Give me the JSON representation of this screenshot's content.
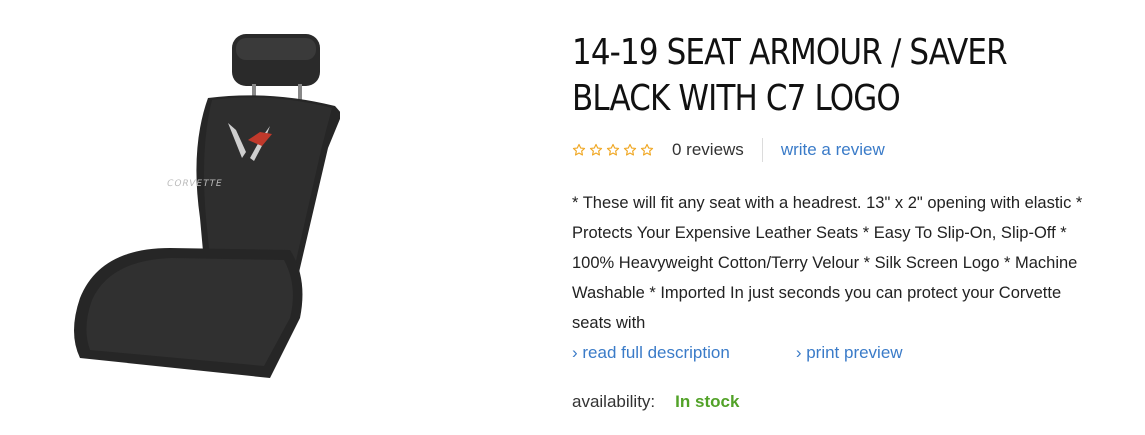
{
  "product": {
    "title": "14-19 SEAT ARMOUR / SAVER BLACK WITH C7 LOGO",
    "image_logo_text": "CORVETTE",
    "rating": {
      "stars_filled": 0,
      "stars_total": 5,
      "reviews_label": "0 reviews",
      "write_review_label": "write a review"
    },
    "description": "* These will fit any seat with a headrest. 13\" x 2\" opening with elastic * Protects Your Expensive Leather Seats * Easy To Slip-On, Slip-Off * 100% Heavyweight Cotton/Terry Velour * Silk Screen Logo * Machine Washable * Imported In just seconds you can protect your Corvette seats with",
    "read_more_label": "› read full description",
    "print_preview_label": "› print preview",
    "availability": {
      "label": "availability:",
      "status": "In stock"
    }
  },
  "colors": {
    "link": "#3a7bc8",
    "star": "#f0a825",
    "in_stock": "#52a228"
  },
  "icons": {
    "star": "star-outline-icon"
  }
}
